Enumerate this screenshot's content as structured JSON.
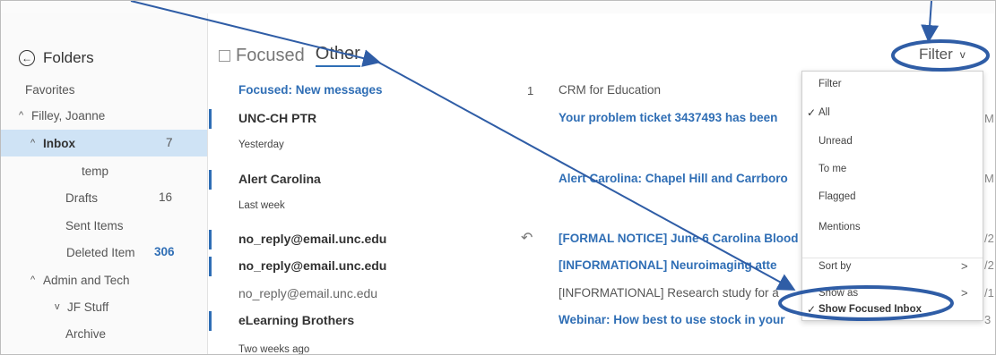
{
  "left_pane": {
    "folders_title": "Folders",
    "back_icon": "circle-arrow-left-icon",
    "items": [
      {
        "label": "Favorites",
        "count": "",
        "caret": ""
      },
      {
        "label": "Filley, Joanne",
        "count": "",
        "caret": "^"
      },
      {
        "label": "Inbox",
        "count": "7",
        "caret": "^"
      },
      {
        "label": "temp",
        "count": "",
        "caret": ""
      },
      {
        "label": "Drafts",
        "count": "16",
        "caret": ""
      },
      {
        "label": "Sent Items",
        "count": "",
        "caret": ""
      },
      {
        "label": "Deleted Item",
        "count": "306",
        "caret": ""
      },
      {
        "label": "Admin and Tech",
        "count": "",
        "caret": "^"
      },
      {
        "label": "JF Stuff",
        "count": "",
        "caret": "v"
      },
      {
        "label": "Archive",
        "count": "",
        "caret": ""
      }
    ]
  },
  "tabs": {
    "focused": "Focused",
    "other": "Other"
  },
  "filter": {
    "label": "Filter",
    "chevron": "v"
  },
  "messages": {
    "focused_new": "Focused: New messages",
    "focused_new_count": "1",
    "crm": "CRM for Education",
    "rows": [
      {
        "sender": "UNC-CH PTR",
        "subject": "Your problem ticket 3437493 has been"
      },
      {
        "sender": "Alert Carolina",
        "subject": "Alert Carolina: Chapel Hill and Carrboro"
      },
      {
        "sender": "no_reply@email.unc.edu",
        "subject": "[FORMAL NOTICE] June 6 Carolina Blood"
      },
      {
        "sender": "no_reply@email.unc.edu",
        "subject": "[INFORMATIONAL] Neuroimaging atte"
      },
      {
        "sender": "no_reply@email.unc.edu",
        "subject": "[INFORMATIONAL] Research study for a"
      },
      {
        "sender": "eLearning Brothers",
        "subject": "Webinar: How best to use stock in your"
      }
    ],
    "sections": {
      "yesterday": "Yesterday",
      "last_week": "Last week",
      "two_weeks": "Two weeks ago"
    },
    "edge_chars": [
      "M",
      "M",
      "/2",
      "/2",
      "/1",
      "3"
    ]
  },
  "filter_menu": {
    "header": "Filter",
    "items": [
      {
        "label": "All",
        "checked": "✓"
      },
      {
        "label": "Unread",
        "checked": ""
      },
      {
        "label": "To me",
        "checked": ""
      },
      {
        "label": "Flagged",
        "checked": ""
      },
      {
        "label": "Mentions",
        "checked": ""
      },
      {
        "label": "Sort by",
        "checked": "",
        "arrow": ">"
      },
      {
        "label": "Show as",
        "checked": "",
        "arrow": ">"
      },
      {
        "label": "Show Focused Inbox",
        "checked": "✓"
      }
    ]
  },
  "colors": {
    "accent": "#2f6eb5",
    "annotation": "#2f5da6",
    "selected_bg": "#cfe3f5"
  }
}
